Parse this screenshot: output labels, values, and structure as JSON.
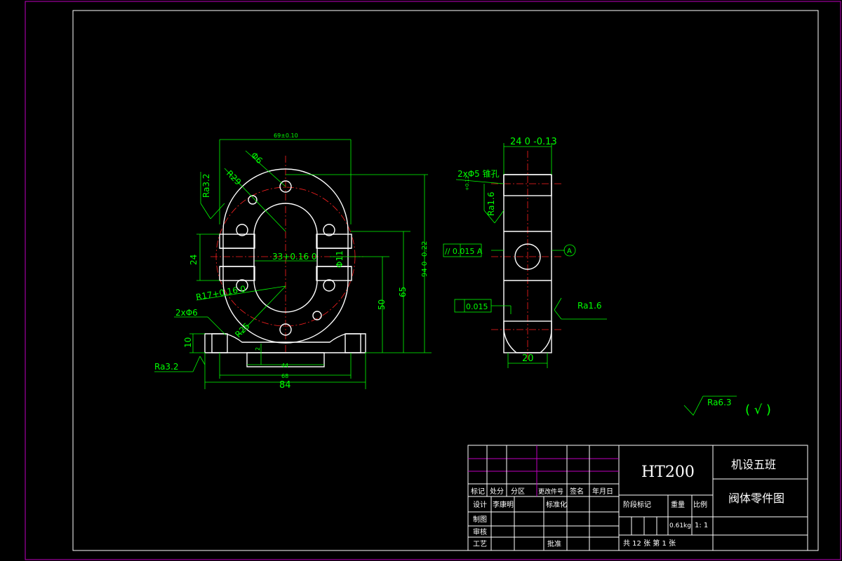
{
  "title_block": {
    "material": "HT200",
    "class_name": "机设五班",
    "drawing_name": "阀体零件图",
    "row_labels": {
      "mark": "标记",
      "count": "处分",
      "zone": "分区",
      "doc_no": "更改件号",
      "sign": "签名",
      "date": "年月日",
      "design": "设计",
      "designer": "李康明",
      "standardize": "标准化",
      "draw": "制图",
      "check": "审核",
      "process": "工艺",
      "approve": "批准",
      "stage": "阶段标记",
      "weight": "重量",
      "scale": "比例",
      "weight_value": "0.61kg",
      "scale_value": "1: 1",
      "total_sheets": "共 12 张 第 1 张"
    }
  },
  "front_view": {
    "dim_top": "69±0.10",
    "dim_hole_top": "Φ6",
    "dim_r29": "R29",
    "dim_ra32_left": "Ra3.2",
    "dim_24": "24",
    "dim_33": "33+0.16 0",
    "dim_bore": "Φ11",
    "dim_r17": "R17+0.16 0",
    "dim_r25": "R25",
    "dim_2xphi6": "2xΦ6",
    "dim_10": "10",
    "dim_2": "2",
    "dim_ra32_bottom": "Ra3.2",
    "dim_44": "44",
    "dim_68": "68",
    "dim_84": "84",
    "dim_50": "50",
    "dim_65": "65",
    "dim_94": "94 0 -0.22"
  },
  "side_view": {
    "dim_24_top": "24 0 -0.13",
    "dim_2xphi5": "2xΦ5 锥孔",
    "dim_small": "+0.12",
    "dim_ra16_top": "Ra1.6",
    "tol_parallel": "// 0.015 A",
    "tol_flat": "0.015",
    "datum": "A",
    "dim_ra16_right": "Ra1.6",
    "dim_20": "20"
  },
  "roughness_note": "Ra6.3",
  "roughness_other": "(   √   )",
  "colors": {
    "outline": "#ffffff",
    "dimension": "#00ff00",
    "center": "#ff2020",
    "border": "#c000c0",
    "hatch": "#c000c0"
  }
}
